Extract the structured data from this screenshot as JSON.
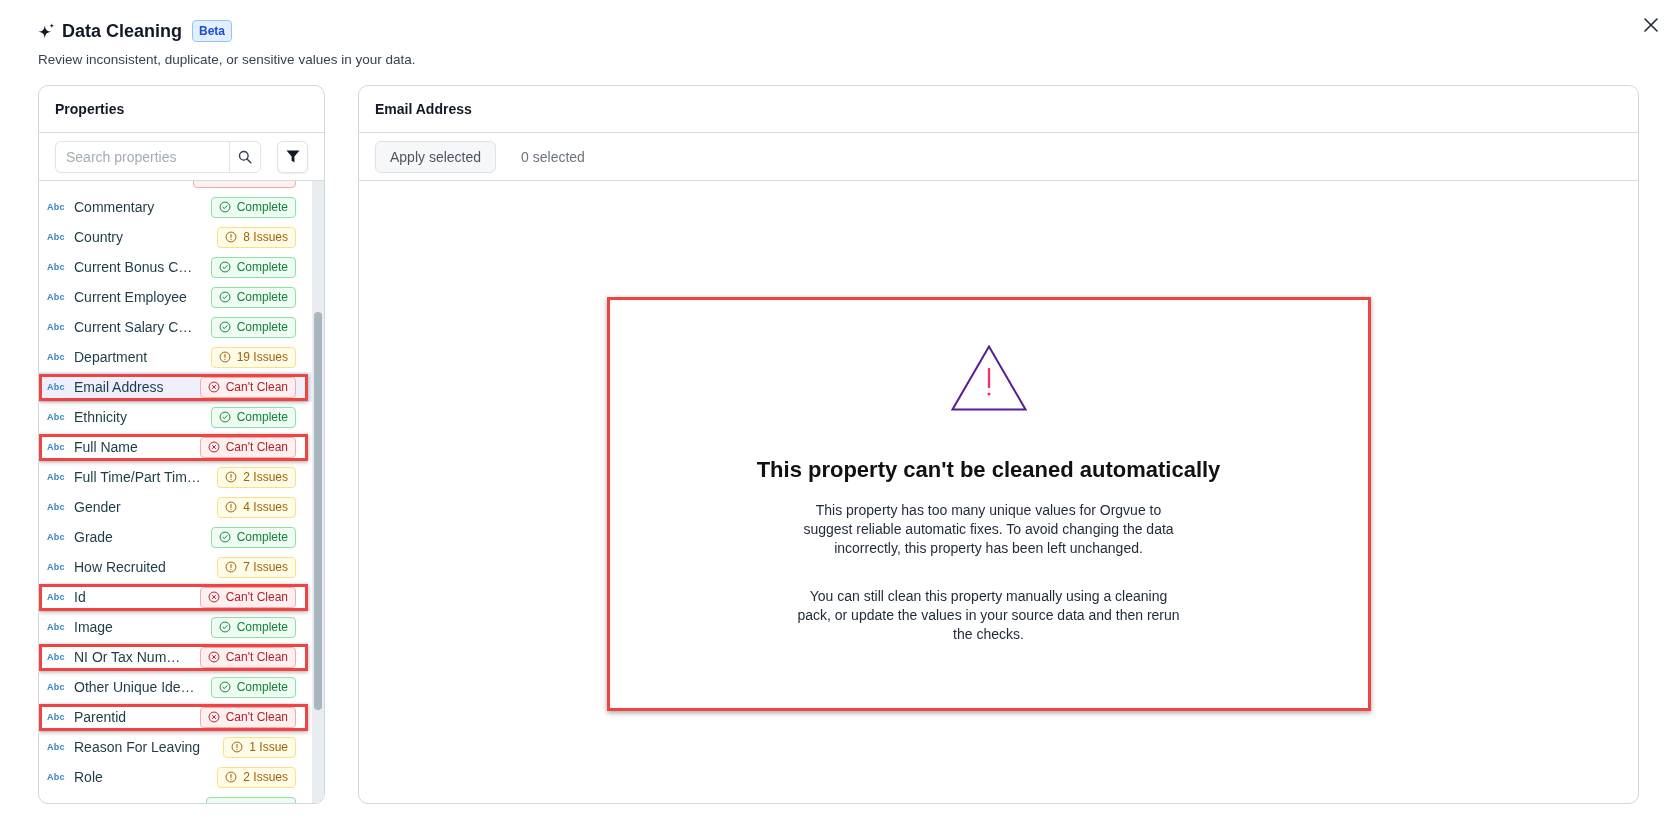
{
  "dialog": {
    "title": "Data Cleaning",
    "badge": "Beta",
    "subtitle": "Review inconsistent, duplicate, or sensitive values in your data."
  },
  "properties": {
    "title": "Properties",
    "search": {
      "placeholder": "Search properties"
    },
    "rows": [
      {
        "kind": "cant_clean",
        "selected": false,
        "highlighted": false
      },
      {
        "type": "Abc",
        "label": "Commentary",
        "kind": "complete",
        "badge": "Complete",
        "selected": false,
        "highlighted": false
      },
      {
        "type": "Abc",
        "label": "Country",
        "kind": "issues",
        "badge": "8 Issues",
        "selected": false,
        "highlighted": false
      },
      {
        "type": "Abc",
        "label": "Current Bonus C…",
        "kind": "complete",
        "badge": "Complete",
        "selected": false,
        "highlighted": false
      },
      {
        "type": "Abc",
        "label": "Current Employee",
        "kind": "complete",
        "badge": "Complete",
        "selected": false,
        "highlighted": false
      },
      {
        "type": "Abc",
        "label": "Current Salary C…",
        "kind": "complete",
        "badge": "Complete",
        "selected": false,
        "highlighted": false
      },
      {
        "type": "Abc",
        "label": "Department",
        "kind": "issues",
        "badge": "19 Issues",
        "selected": false,
        "highlighted": false
      },
      {
        "type": "Abc",
        "label": "Email Address",
        "kind": "cant_clean",
        "badge": "Can't Clean",
        "selected": true,
        "highlighted": true
      },
      {
        "type": "Abc",
        "label": "Ethnicity",
        "kind": "complete",
        "badge": "Complete",
        "selected": false,
        "highlighted": false
      },
      {
        "type": "Abc",
        "label": "Full Name",
        "kind": "cant_clean",
        "badge": "Can't Clean",
        "selected": false,
        "highlighted": true
      },
      {
        "type": "Abc",
        "label": "Full Time/Part Tim…",
        "kind": "issues",
        "badge": "2 Issues",
        "selected": false,
        "highlighted": false
      },
      {
        "type": "Abc",
        "label": "Gender",
        "kind": "issues",
        "badge": "4 Issues",
        "selected": false,
        "highlighted": false
      },
      {
        "type": "Abc",
        "label": "Grade",
        "kind": "complete",
        "badge": "Complete",
        "selected": false,
        "highlighted": false
      },
      {
        "type": "Abc",
        "label": "How Recruited",
        "kind": "issues",
        "badge": "7 Issues",
        "selected": false,
        "highlighted": false
      },
      {
        "type": "Abc",
        "label": "Id",
        "kind": "cant_clean",
        "badge": "Can't Clean",
        "selected": false,
        "highlighted": true
      },
      {
        "type": "Abc",
        "label": "Image",
        "kind": "complete",
        "badge": "Complete",
        "selected": false,
        "highlighted": false
      },
      {
        "type": "Abc",
        "label": "NI Or Tax Num…",
        "kind": "cant_clean",
        "badge": "Can't Clean",
        "selected": false,
        "highlighted": true
      },
      {
        "type": "Abc",
        "label": "Other Unique Ide…",
        "kind": "complete",
        "badge": "Complete",
        "selected": false,
        "highlighted": false
      },
      {
        "type": "Abc",
        "label": "Parentid",
        "kind": "cant_clean",
        "badge": "Can't Clean",
        "selected": false,
        "highlighted": true
      },
      {
        "type": "Abc",
        "label": "Reason For Leaving",
        "kind": "issues",
        "badge": "1 Issue",
        "selected": false,
        "highlighted": false
      },
      {
        "type": "Abc",
        "label": "Role",
        "kind": "issues",
        "badge": "2 Issues",
        "selected": false,
        "highlighted": false
      },
      {
        "kind": "complete",
        "selected": false,
        "highlighted": false
      }
    ]
  },
  "detail": {
    "title": "Email Address",
    "apply_button": "Apply selected",
    "selected_count": "0 selected",
    "message": {
      "highlighted": true,
      "title": "This property can't be cleaned automatically",
      "paragraphs": [
        "This property has too many unique values for Orgvue to suggest reliable automatic fixes. To avoid changing the data incorrectly, this property has been left unchanged.",
        "You can still clean this property manually using a cleaning pack, or update the values in your source data and then rerun the checks."
      ]
    }
  }
}
